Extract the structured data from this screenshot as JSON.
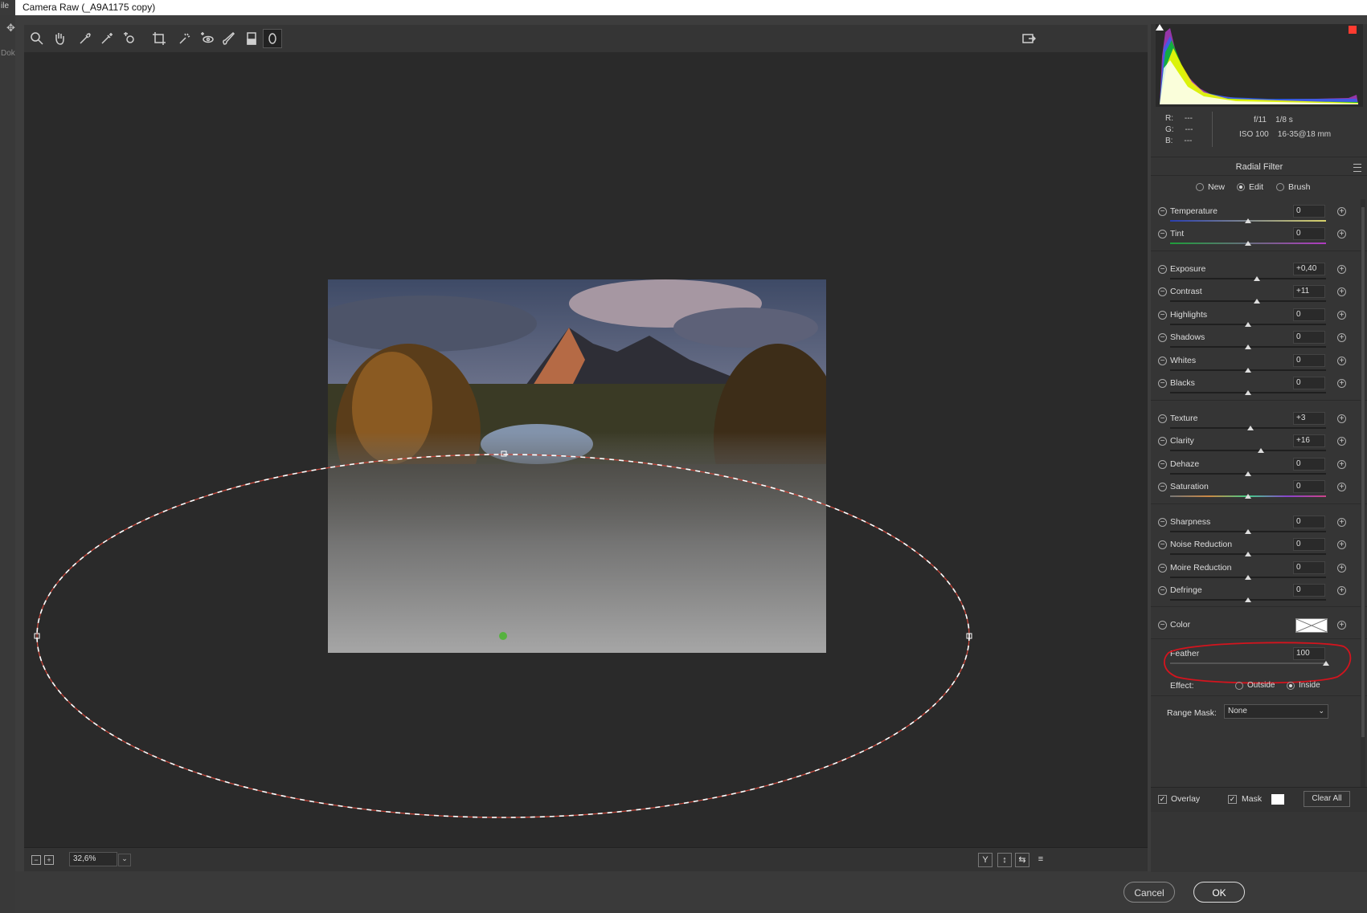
{
  "window": {
    "title": "Camera Raw (_A9A1175 copy)",
    "ps_menu_fragment": "ile",
    "ps_left_label": "Dok"
  },
  "toolbar": {
    "tools": [
      "zoom-icon",
      "hand-icon",
      "white-balance-icon",
      "color-sampler-icon",
      "targeted-adjustment-icon",
      "crop-icon",
      "spot-removal-icon",
      "red-eye-icon",
      "adjustment-brush-icon",
      "graduated-filter-icon",
      "radial-filter-icon"
    ],
    "export_icon": "open-preferences-icon"
  },
  "status": {
    "zoom_out": "−",
    "zoom_in": "+",
    "zoom": "32,6%",
    "chevron": "⌄",
    "icons": [
      "Y",
      "↕",
      "⇆",
      "≡"
    ]
  },
  "buttons": {
    "cancel": "Cancel",
    "ok": "OK"
  },
  "histogram": {
    "colors": {
      "red": "#ff3b30",
      "yellow": "#ffff00",
      "blue": "#1e6bff",
      "green": "#00d000",
      "magenta": "#e040ff",
      "white": "#ffffff"
    }
  },
  "readout": {
    "r": "R:",
    "g": "G:",
    "b": "B:",
    "r_val": "---",
    "g_val": "---",
    "b_val": "---",
    "aperture": "f/11",
    "shutter": "1/8 s",
    "iso": "ISO 100",
    "lens": "16-35@18 mm"
  },
  "panel": {
    "title": "Radial Filter",
    "modes": [
      {
        "label": "New",
        "selected": false
      },
      {
        "label": "Edit",
        "selected": true
      },
      {
        "label": "Brush",
        "selected": false
      }
    ],
    "sliders": [
      {
        "label": "Temperature",
        "value": "0",
        "pos": 0.5
      },
      {
        "label": "Tint",
        "value": "0",
        "pos": 0.5
      },
      {
        "label": "Exposure",
        "value": "+0,40",
        "pos": 0.555
      },
      {
        "label": "Contrast",
        "value": "+11",
        "pos": 0.555
      },
      {
        "label": "Highlights",
        "value": "0",
        "pos": 0.5
      },
      {
        "label": "Shadows",
        "value": "0",
        "pos": 0.5
      },
      {
        "label": "Whites",
        "value": "0",
        "pos": 0.5
      },
      {
        "label": "Blacks",
        "value": "0",
        "pos": 0.5
      },
      {
        "label": "Texture",
        "value": "+3",
        "pos": 0.515
      },
      {
        "label": "Clarity",
        "value": "+16",
        "pos": 0.58
      },
      {
        "label": "Dehaze",
        "value": "0",
        "pos": 0.5
      },
      {
        "label": "Saturation",
        "value": "0",
        "pos": 0.5
      },
      {
        "label": "Sharpness",
        "value": "0",
        "pos": 0.5
      },
      {
        "label": "Noise Reduction",
        "value": "0",
        "pos": 0.5
      },
      {
        "label": "Moire Reduction",
        "value": "0",
        "pos": 0.5
      },
      {
        "label": "Defringe",
        "value": "0",
        "pos": 0.5
      }
    ],
    "color_label": "Color",
    "feather": {
      "label": "Feather",
      "value": "100",
      "pos": 1.0
    },
    "effect": {
      "label": "Effect:",
      "outside": "Outside",
      "inside": "Inside",
      "selected": "Inside"
    },
    "range_mask": {
      "label": "Range Mask:",
      "value": "None",
      "chevron": "⌄"
    },
    "footer": {
      "overlay": "Overlay",
      "overlay_checked": true,
      "mask": "Mask",
      "mask_checked": true,
      "clear_all": "Clear All",
      "checkmark": "✓"
    }
  }
}
